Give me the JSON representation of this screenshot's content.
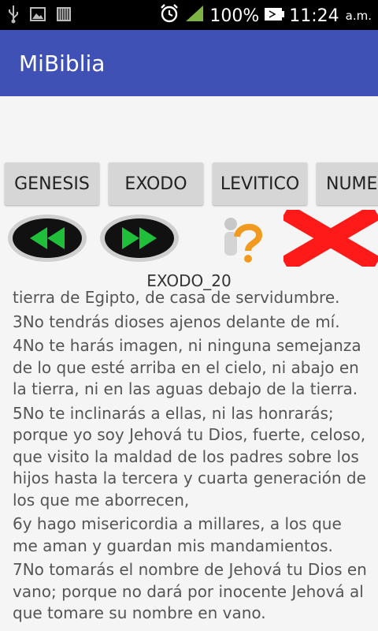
{
  "status_bar": {
    "battery": "100%",
    "time": "11:24",
    "ampm": "a.m.",
    "icons": [
      "usb-icon",
      "image-icon",
      "barcode-icon",
      "alarm-icon",
      "signal-icon",
      "battery-icon"
    ]
  },
  "app_bar": {
    "title": "MiBiblia",
    "color": "#3f51b5"
  },
  "books": [
    "GENESIS",
    "EXODO",
    "LEVITICO",
    "NUME"
  ],
  "nav": {
    "prev_icon": "rewind-icon",
    "next_icon": "fast-forward-icon",
    "help_icon": "help-question-icon",
    "close_icon": "close-x-icon"
  },
  "chapter_label": "EXODO_20",
  "verses": [
    "tierra de Egipto, de casa de servidumbre.",
    "3No tendrás dioses ajenos delante de mí.",
    "4No te harás imagen, ni ninguna semejanza de lo que esté arriba en el cielo, ni abajo en la tierra, ni en las aguas debajo de la tierra.",
    "5No te inclinarás a ellas, ni las honrarás; porque yo soy Jehová tu Dios, fuerte, celoso, que visito la maldad de los padres sobre los hijos hasta la tercera y cuarta generación de los que me aborrecen,",
    "6y hago misericordia a millares, a los que me aman y guardan mis mandamientos.",
    "7No tomarás el nombre de Jehová tu Dios en vano; porque no dará por inocente Jehová al que tomare su nombre en vano."
  ]
}
